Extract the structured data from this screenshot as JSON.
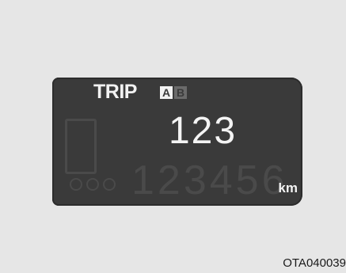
{
  "display": {
    "trip_label": "TRIP",
    "trip_a": "A",
    "trip_b": "B",
    "trip_value": "123",
    "odometer_background": "123456",
    "unit": "km"
  },
  "caption": "OTA040039"
}
